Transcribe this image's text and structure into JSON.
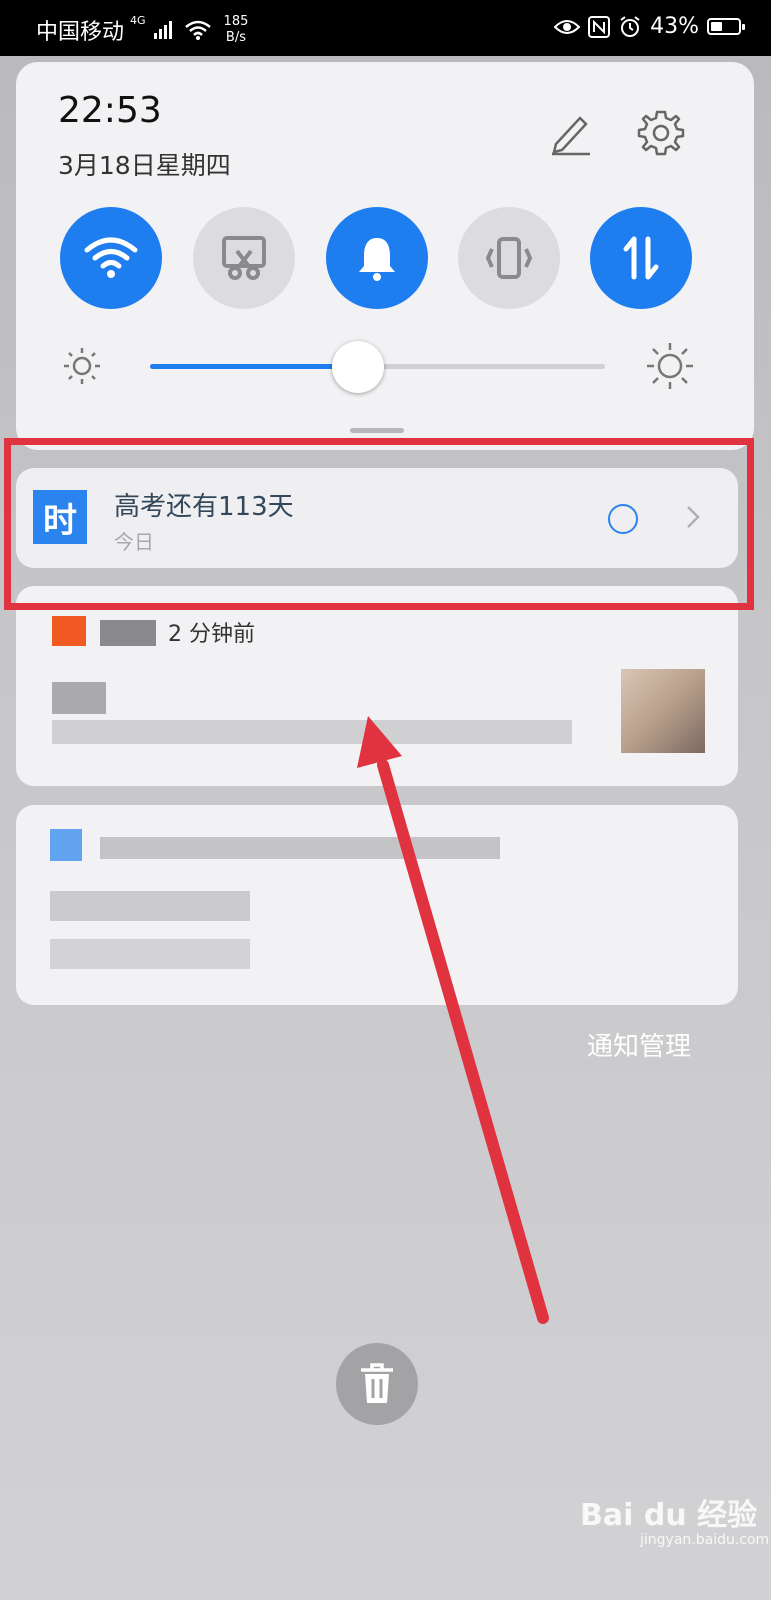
{
  "status_bar": {
    "carrier": "中国移动",
    "network": "4G",
    "speed_value": "185",
    "speed_unit": "B/s",
    "battery": "43%",
    "battery_level": 0.43
  },
  "quick_panel": {
    "time": "22:53",
    "date": "3月18日星期四",
    "toggles": [
      {
        "name": "wifi",
        "state": "on"
      },
      {
        "name": "screenshot",
        "state": "off"
      },
      {
        "name": "sound",
        "state": "on"
      },
      {
        "name": "vibrate",
        "state": "off"
      },
      {
        "name": "mobile-data",
        "state": "on"
      }
    ],
    "brightness_fraction": 0.45
  },
  "notifications": [
    {
      "app_icon_text": "时",
      "title": "高考还有113天",
      "subtitle": "今日"
    },
    {
      "time": "2 分钟前"
    }
  ],
  "notification_manage_label": "通知管理",
  "watermark": {
    "brand": "Bai du 经验",
    "url": "jingyan.baidu.com"
  },
  "colors": {
    "accent": "#1e7ef0",
    "highlight": "#e0323f"
  }
}
